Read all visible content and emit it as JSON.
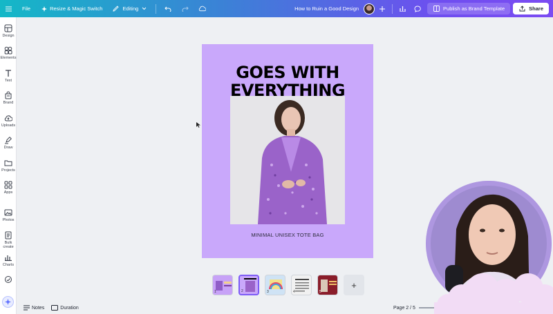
{
  "topbar": {
    "menu_icon": "hamburger-icon",
    "file_label": "File",
    "resize_label": "Resize & Magic Switch",
    "editing_label": "Editing",
    "design_title": "How to Ruin a Good Design",
    "publish_label": "Publish as Brand Template",
    "share_label": "Share"
  },
  "sidebar": {
    "items": [
      {
        "label": "Design",
        "icon": "layout-icon"
      },
      {
        "label": "Elements",
        "icon": "shapes-icon"
      },
      {
        "label": "Text",
        "icon": "text-icon"
      },
      {
        "label": "Brand",
        "icon": "brand-icon"
      },
      {
        "label": "Uploads",
        "icon": "cloud-upload-icon"
      },
      {
        "label": "Draw",
        "icon": "pen-icon"
      },
      {
        "label": "Projects",
        "icon": "folder-icon"
      },
      {
        "label": "Apps",
        "icon": "apps-grid-icon"
      },
      {
        "label": "Photos",
        "icon": "image-icon"
      },
      {
        "label": "Bulk create",
        "icon": "bulk-create-icon"
      },
      {
        "label": "Charts",
        "icon": "chart-icon"
      },
      {
        "label": "",
        "icon": "more-icon"
      }
    ]
  },
  "design": {
    "headline_line1": "GOES WITH",
    "headline_line2": "EVERYTHING",
    "subtitle": "MINIMAL UNISEX TOTE BAG",
    "background_color": "#c9a8fb"
  },
  "pages": {
    "thumbnails": [
      {
        "num": "1",
        "color": "#c7a2f7"
      },
      {
        "num": "2",
        "color": "#c9a8fb"
      },
      {
        "num": "3",
        "color": "#cfe3f5"
      },
      {
        "num": "4",
        "color": "#f1f1f1"
      },
      {
        "num": "5",
        "color": "#8a1d2a"
      }
    ],
    "add_label": "+",
    "indicator": "Page 2 / 5"
  },
  "bottombar": {
    "notes_label": "Notes",
    "duration_label": "Duration"
  },
  "colors": {
    "accent": "#7c5cf5",
    "topbar_start": "#14b8c7",
    "topbar_end": "#7b4cf2"
  }
}
